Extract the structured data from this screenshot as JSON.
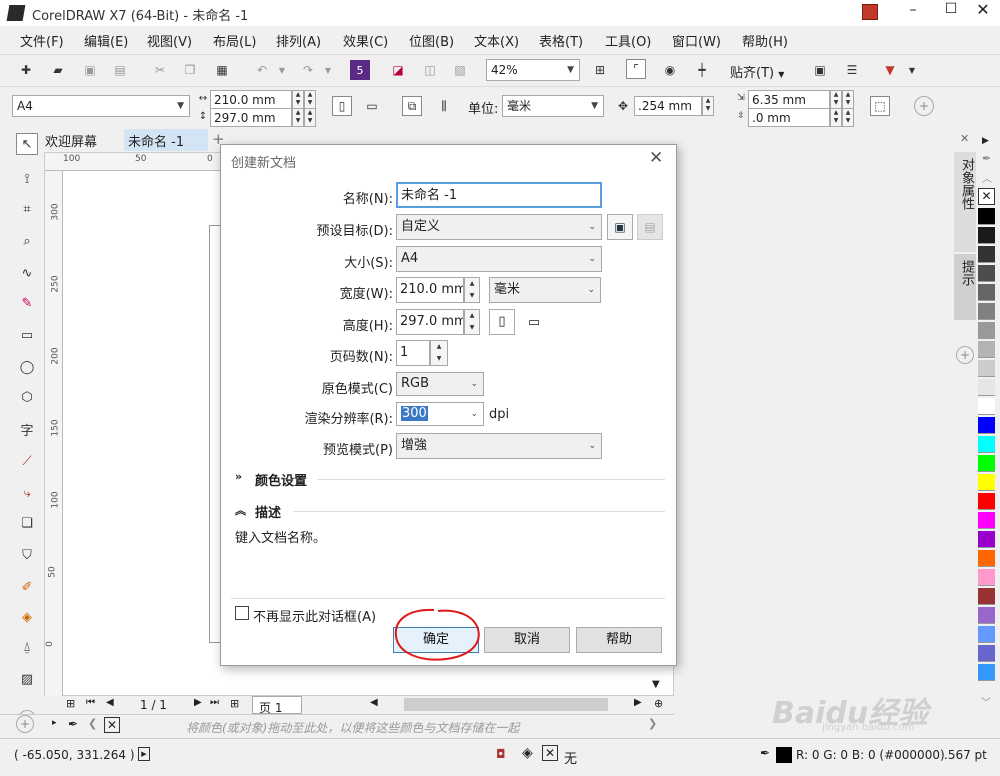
{
  "titlebar": {
    "title": "CorelDRAW X7 (64-Bit) - 未命名 -1"
  },
  "menu": [
    "文件(F)",
    "编辑(E)",
    "视图(V)",
    "布局(L)",
    "排列(A)",
    "效果(C)",
    "位图(B)",
    "文本(X)",
    "表格(T)",
    "工具(O)",
    "窗口(W)",
    "帮助(H)"
  ],
  "toolbar": {
    "zoom": "42%",
    "snap_label": "贴齐(T)"
  },
  "propbar": {
    "page_size": "A4",
    "width": "210.0 mm",
    "height": "297.0 mm",
    "units_label": "单位:",
    "units": "毫米",
    "nudge": ".254 mm",
    "dup_x": "6.35 mm",
    "dup_y": ".0 mm"
  },
  "doc_tabs": [
    "欢迎屏幕",
    "未命名 -1"
  ],
  "ruler_h": [
    "100",
    "50",
    "0"
  ],
  "ruler_v": [
    "300",
    "250",
    "200",
    "150",
    "100",
    "50",
    "0"
  ],
  "side_tabs": [
    "对象属性",
    "提示"
  ],
  "dialog": {
    "title": "创建新文档",
    "name_label": "名称(N):",
    "name_value": "未命名 -1",
    "preset_label": "预设目标(D):",
    "preset_value": "自定义",
    "size_label": "大小(S):",
    "size_value": "A4",
    "width_label": "宽度(W):",
    "width_value": "210.0 mm",
    "width_units": "毫米",
    "height_label": "高度(H):",
    "height_value": "297.0 mm",
    "pages_label": "页码数(N):",
    "pages_value": "1",
    "color_mode_label": "原色模式(C)",
    "color_mode_value": "RGB",
    "resolution_label": "渲染分辨率(R):",
    "resolution_value": "300",
    "resolution_unit": "dpi",
    "preview_label": "预览模式(P)",
    "preview_value": "增強",
    "color_settings": "颜色设置",
    "description_header": "描述",
    "description_text": "键入文档名称。",
    "dont_show": "不再显示此对话框(A)",
    "ok": "确定",
    "cancel": "取消",
    "help": "帮助"
  },
  "pagenav": {
    "counter": "1 / 1",
    "page_tab": "页 1"
  },
  "palette_tray": {
    "hint": "将颜色(或对象)拖动至此处，以便将这些颜色与文档存储在一起"
  },
  "status": {
    "coords": "( -65.050, 331.264 )",
    "fill_none": "无",
    "color_info": "R: 0 G: 0 B: 0 (#000000)",
    "outline": ".567 pt"
  },
  "palette": [
    "#ffffff",
    "#000000",
    "#1a1a1a",
    "#333333",
    "#4d4d4d",
    "#666666",
    "#808080",
    "#999999",
    "#b3b3b3",
    "#cccccc",
    "#e6e6e6",
    "#ffffff",
    "#0000ff",
    "#00ffff",
    "#00ff00",
    "#ffff00",
    "#ff0000",
    "#ff00ff",
    "#9900cc",
    "#ff6600",
    "#ff99cc",
    "#993333",
    "#9966cc",
    "#6699ff",
    "#6666cc",
    "#3399ff"
  ],
  "watermark": {
    "text": "Baidu经验",
    "url": "jingyan.baidu.com"
  }
}
